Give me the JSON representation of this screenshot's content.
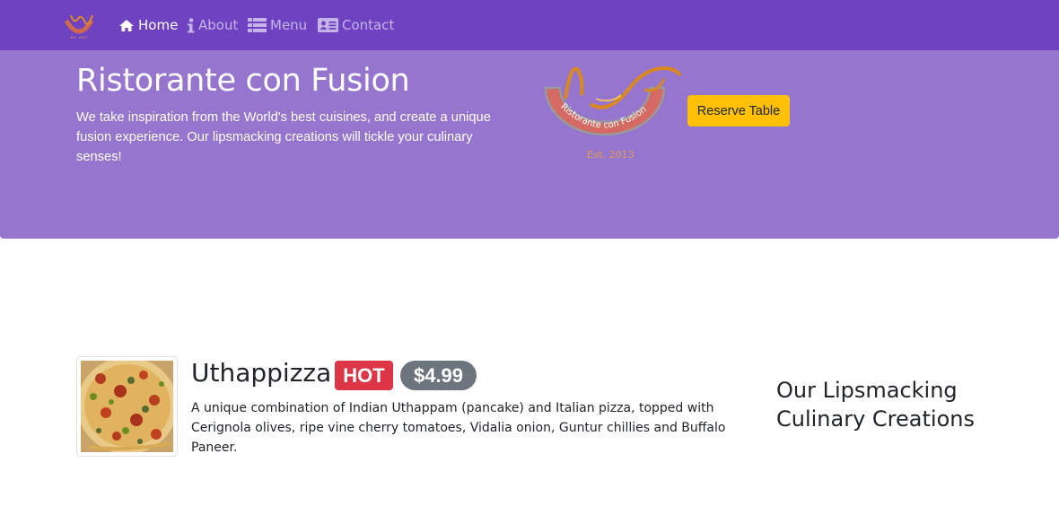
{
  "navbar": {
    "brand_logo_icon": "restaurant-logo-icon",
    "items": [
      {
        "label": "Home",
        "icon": "home-icon",
        "active": true
      },
      {
        "label": "About",
        "icon": "info-icon",
        "active": false
      },
      {
        "label": "Menu",
        "icon": "list-icon",
        "active": false
      },
      {
        "label": "Contact",
        "icon": "address-card-icon",
        "active": false
      }
    ]
  },
  "jumbotron": {
    "title": "Ristorante con Fusion",
    "description": "We take inspiration from the World's best cuisines, and create a unique fusion experience. Our lipsmacking creations will tickle your culinary senses!",
    "logo": {
      "name_text": "Ristorante con Fusion",
      "est_text": "Est. 2013"
    },
    "reserve_label": "Reserve Table"
  },
  "dish": {
    "name": "Uthappizza",
    "badge": "HOT",
    "price": "$4.99",
    "description": "A unique combination of Indian Uthappam (pancake) and Italian pizza, topped with Cerignola olives, ripe vine cherry tomatoes, Vidalia onion, Guntur chillies and Buffalo Paneer."
  },
  "side": {
    "heading": "Our Lipsmacking Culinary Creations"
  },
  "colors": {
    "navbar_bg": "#6e42c1",
    "jumbotron_bg": "#9575cd",
    "reserve_button": "#ffc107",
    "hot_badge": "#dc3545",
    "price_badge": "#6c757d"
  }
}
